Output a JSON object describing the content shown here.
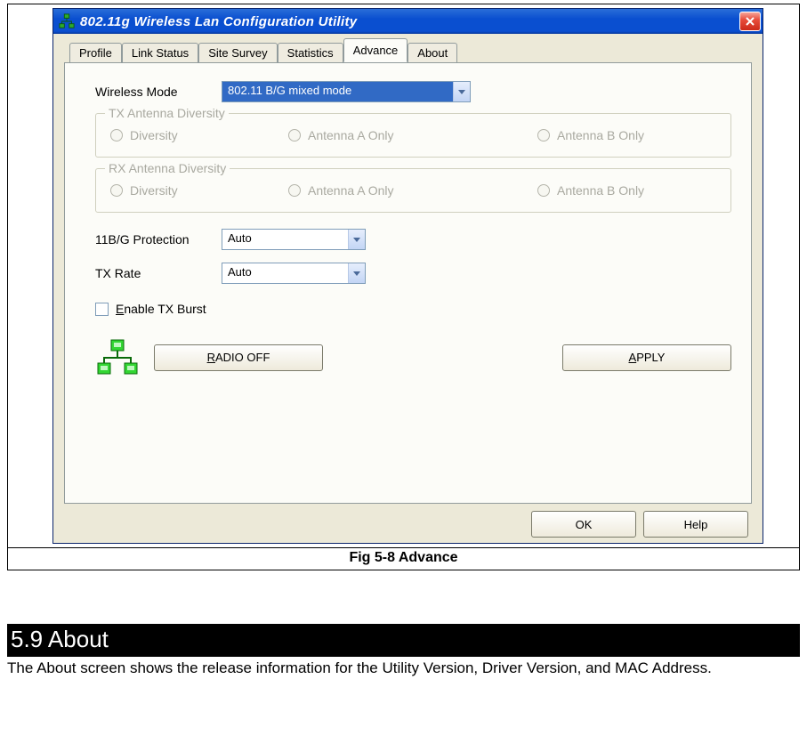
{
  "window": {
    "title": "802.11g Wireless Lan Configuration Utility",
    "close": "X"
  },
  "tabs": {
    "items": [
      "Profile",
      "Link Status",
      "Site Survey",
      "Statistics",
      "Advance",
      "About"
    ],
    "active_index": 4
  },
  "advance": {
    "wireless_mode_label": "Wireless Mode",
    "wireless_mode_value": "802.11 B/G mixed mode",
    "tx_group_title": "TX Antenna Diversity",
    "rx_group_title": "RX Antenna Diversity",
    "radio_option_a": "Diversity",
    "radio_option_b": "Antenna A Only",
    "radio_option_c": "Antenna B Only",
    "protection_label": "11B/G Protection",
    "protection_value": "Auto",
    "txrate_label": "TX Rate",
    "txrate_value": "Auto",
    "enable_tx_burst_prefix": "E",
    "enable_tx_burst_rest": "nable TX Burst",
    "radio_off_prefix": "R",
    "radio_off_rest": "ADIO OFF",
    "apply_prefix": "A",
    "apply_rest": "PPLY"
  },
  "dialog": {
    "ok": "OK",
    "help": "Help"
  },
  "caption": "Fig 5-8 Advance",
  "section": {
    "heading": "5.9 About",
    "body": "The About screen shows the release information for the Utility Version, Driver Version, and MAC Address."
  }
}
